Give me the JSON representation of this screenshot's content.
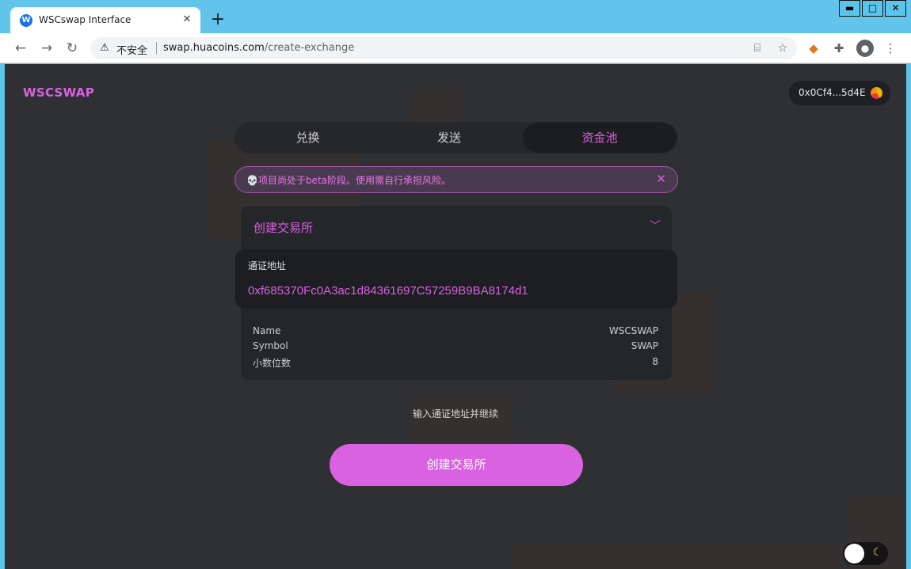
{
  "browser": {
    "tab_title": "WSCswap Interface",
    "tab_favicon": "W",
    "tab_close": "✕",
    "new_tab": "+",
    "window_buttons": [
      "▬",
      "□",
      "✕"
    ],
    "security_label": "不安全",
    "url_host": "swap.huacoins.com",
    "url_path": "/create-exchange"
  },
  "header": {
    "logo": "WSCSWAP",
    "wallet_address": "0x0Cf4...5d4E"
  },
  "tabs": [
    {
      "label": "兑换",
      "active": false
    },
    {
      "label": "发送",
      "active": false
    },
    {
      "label": "资金池",
      "active": true
    }
  ],
  "banner": {
    "text": "💀项目尚处于beta阶段。使用需自行承担风险。",
    "close": "✕"
  },
  "create_card": {
    "title": "创建交易所",
    "token_label": "通证地址",
    "token_address": "0xf685370Fc0A3ac1d84361697C57259B9BA8174d1",
    "info": [
      {
        "label": "Name",
        "value": "WSCSWAP"
      },
      {
        "label": "Symbol",
        "value": "SWAP"
      },
      {
        "label": "小数位数",
        "value": "8"
      }
    ]
  },
  "hint": "输入通证地址并继续",
  "create_button": "创建交易所",
  "colors": {
    "accent": "#d962e0",
    "page_background": "#2e3034",
    "card_background": "#25262a",
    "browser_frame": "#62c4ea"
  },
  "icons": [
    "back-icon",
    "forward-icon",
    "reload-icon",
    "warning-icon",
    "translate-icon",
    "star-icon",
    "metamask-icon",
    "extensions-icon",
    "profile-icon",
    "menu-icon",
    "chevron-down-icon",
    "moon-icon"
  ]
}
